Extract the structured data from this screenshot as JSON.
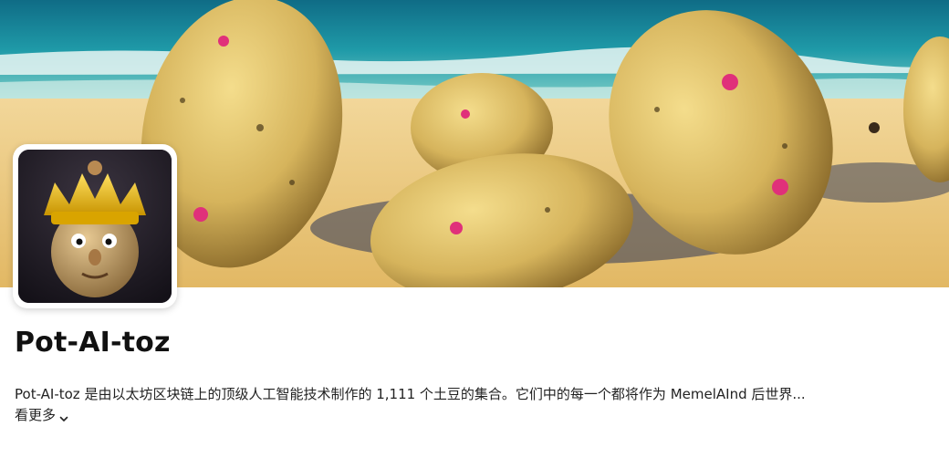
{
  "collection": {
    "name": "Pot-AI-toz",
    "description": "Pot-AI-toz 是由以太坊区块链上的顶级人工智能技术制作的 1,111 个土豆的集合。它们中的每一个都将作为 MemelAInd 后世界...",
    "see_more_label": "看更多"
  },
  "icons": {
    "see_more": "chevron-down-icon"
  },
  "colors": {
    "background": "#ffffff",
    "title": "#111111",
    "text": "#222222"
  }
}
